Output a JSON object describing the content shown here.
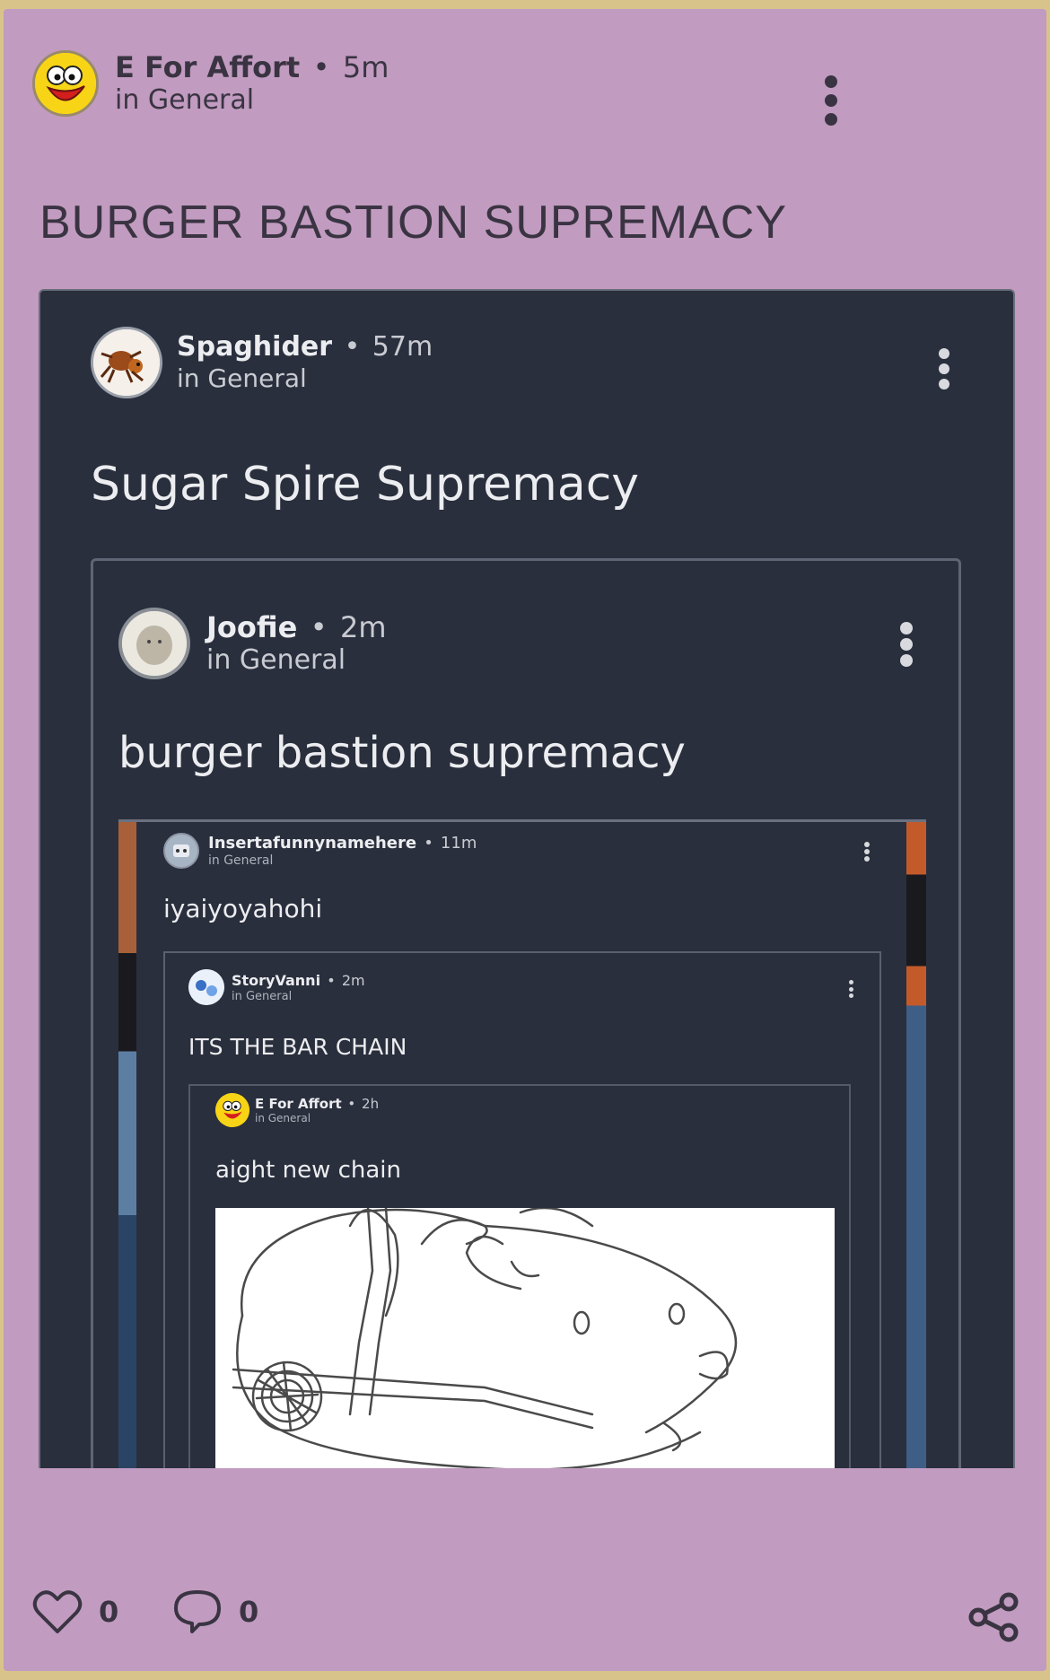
{
  "colors": {
    "outer_bg": "#d8c48a",
    "card_bg": "#c19bc0",
    "dark_panel": "#2a2f3d",
    "dark_border": "#7f8696",
    "card_text": "#3a3442",
    "panel_text": "#ecedf0",
    "panel_meta": "#c9cbd2"
  },
  "post": {
    "author": "E For Affort",
    "time": "5m",
    "channel": "in General",
    "title": "BURGER BASTION SUPREMACY",
    "likes": "0",
    "comments": "0"
  },
  "embed1": {
    "author": "Spaghider",
    "time": "57m",
    "channel": "in General",
    "title": "Sugar Spire Supremacy"
  },
  "embed2": {
    "author": "Joofie",
    "time": "2m",
    "channel": "in General",
    "title": "burger bastion supremacy"
  },
  "embed3": {
    "author": "Insertafunnynamehere",
    "time": "11m",
    "channel": "in General",
    "title": "iyaiyoyahohi"
  },
  "embed4": {
    "author": "StoryVanni",
    "time": "2m",
    "channel": "in General",
    "title": "ITS THE BAR CHAIN"
  },
  "embed5": {
    "author": "E For Affort",
    "time": "2h",
    "channel": "in General",
    "title": "aight new chain"
  },
  "icons": {
    "like": "heart-icon",
    "comment": "speech-bubble-icon",
    "share": "share-icon",
    "more": "more-options-icon"
  }
}
